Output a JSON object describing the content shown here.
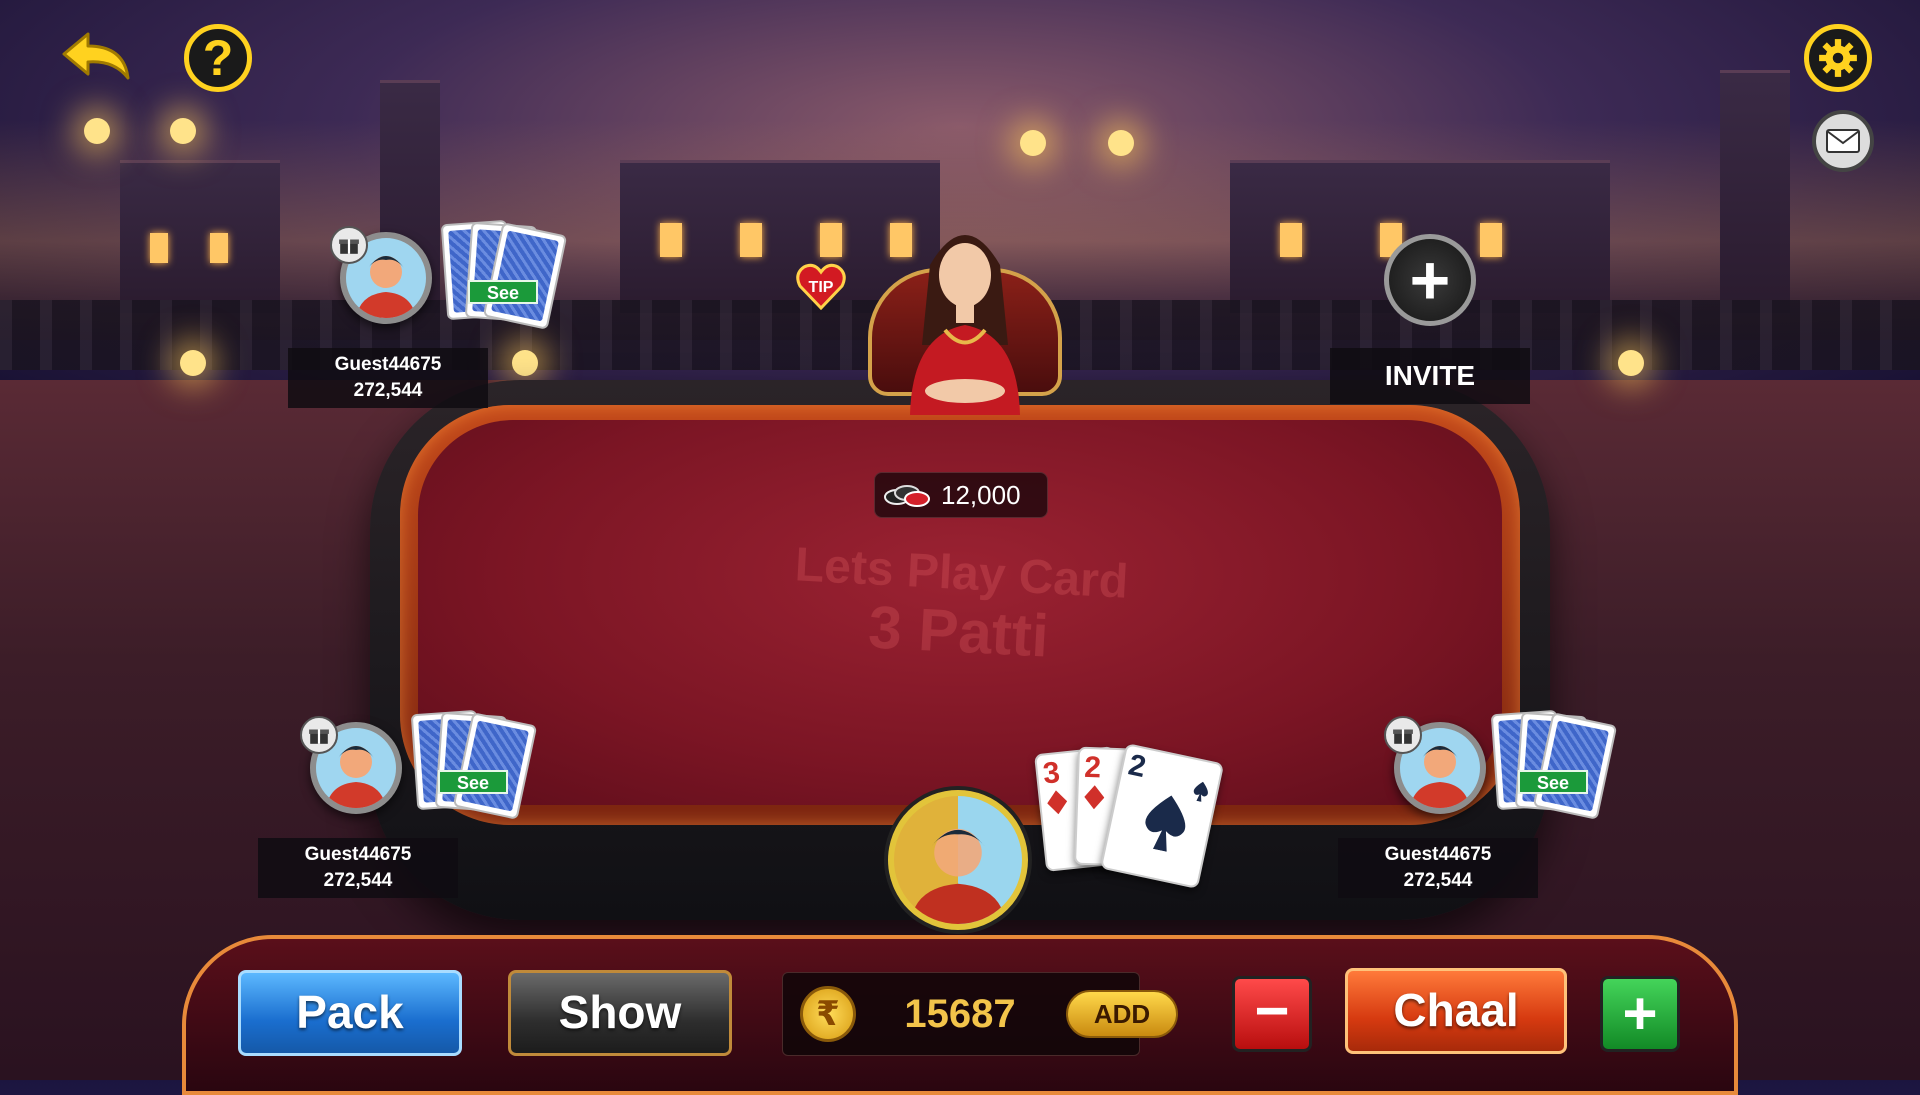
{
  "table": {
    "watermark_line1": "Lets Play Card",
    "watermark_line2": "3 Patti",
    "pot_amount": "12,000"
  },
  "top_bar": {
    "back_icon": "back-arrow-icon",
    "help_label": "?",
    "settings_icon": "gear-icon",
    "mail_icon": "mail-icon"
  },
  "dealer": {
    "tip_label": "TIP"
  },
  "invite": {
    "label": "INVITE",
    "plus": "+"
  },
  "players": [
    {
      "name": "Guest44675",
      "chips": "272,544",
      "see_label": "See"
    },
    {
      "name": "Guest44675",
      "chips": "272,544",
      "see_label": "See"
    },
    {
      "name": "Guest44675",
      "chips": "272,544",
      "see_label": "See"
    }
  ],
  "my_hand": [
    {
      "rank": "3",
      "suit": "diamond",
      "color": "#d0302a"
    },
    {
      "rank": "2",
      "suit": "diamond",
      "color": "#d0302a"
    },
    {
      "rank": "2",
      "suit": "spade",
      "color": "#1a2a4a"
    }
  ],
  "controls": {
    "pack_label": "Pack",
    "show_label": "Show",
    "rupee_symbol": "₹",
    "balance": "15687",
    "add_label": "ADD",
    "minus_label": "−",
    "chaal_label": "Chaal",
    "plus_label": "+"
  },
  "colors": {
    "accent_yellow": "#ffd21f",
    "felt_red": "#7b1524",
    "pack_blue": "#1a6ecf",
    "chaal_orange": "#d63a10",
    "see_green": "#1b9a3a"
  }
}
